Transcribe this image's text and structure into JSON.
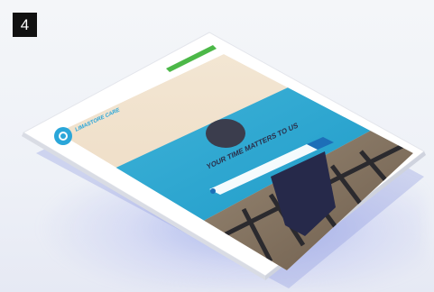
{
  "badge": {
    "number": "4"
  },
  "site": {
    "logo_text": "LIMASTORE CARE",
    "hero_title": "YOUR TIME MATTERS TO US",
    "cta_color": "#4cb848",
    "accent_color": "#2aa6d9"
  },
  "icons": [
    "logo-icon",
    "search-icon"
  ]
}
